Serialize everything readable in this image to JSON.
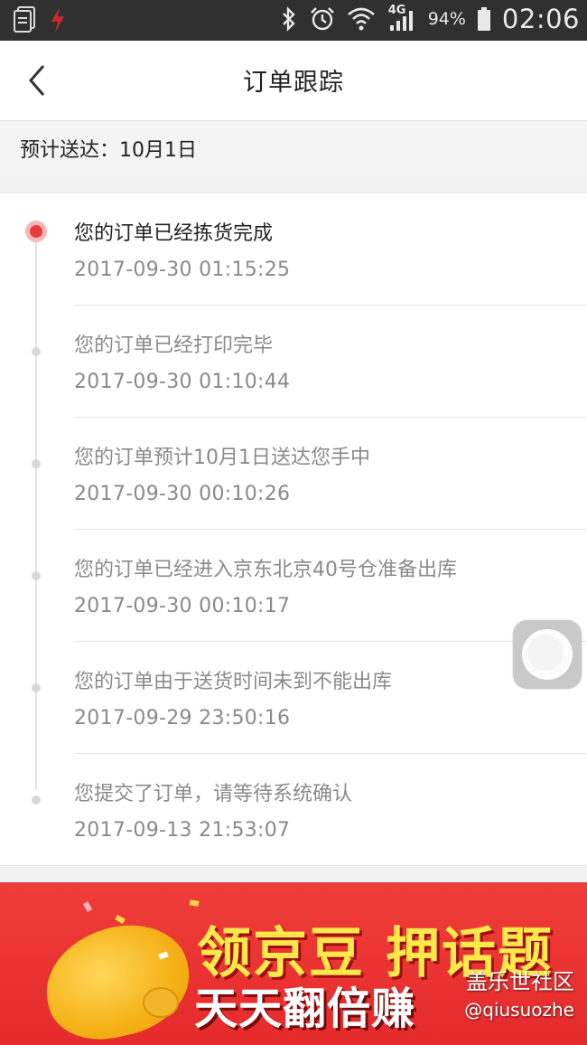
{
  "status_bar": {
    "battery": "94%",
    "network": "4G",
    "time": "02:06"
  },
  "nav": {
    "title": "订单跟踪"
  },
  "expected_delivery": "预计送达：10月1日",
  "timeline": [
    {
      "message": "您的订单已经拣货完成",
      "time": "2017-09-30 01:15:25",
      "active": true
    },
    {
      "message": "您的订单已经打印完毕",
      "time": "2017-09-30 01:10:44",
      "active": false
    },
    {
      "message": "您的订单预计10月1日送达您手中",
      "time": "2017-09-30 00:10:26",
      "active": false
    },
    {
      "message": "您的订单已经进入京东北京40号仓准备出库",
      "time": "2017-09-30 00:10:17",
      "active": false
    },
    {
      "message": "您的订单由于送货时间未到不能出库",
      "time": "2017-09-29 23:50:16",
      "active": false
    },
    {
      "message": "您提交了订单，请等待系统确认",
      "time": "2017-09-13 21:53:07",
      "active": false
    }
  ],
  "banner": {
    "line1": "领京豆 押话题",
    "line2": "天天翻倍赚"
  },
  "watermark": {
    "line1": "盖乐世社区",
    "line2": "@qiusuozhe"
  },
  "colors": {
    "accent_red": "#e93b3d",
    "text_primary": "#222222",
    "text_secondary": "#8a8a8a"
  }
}
